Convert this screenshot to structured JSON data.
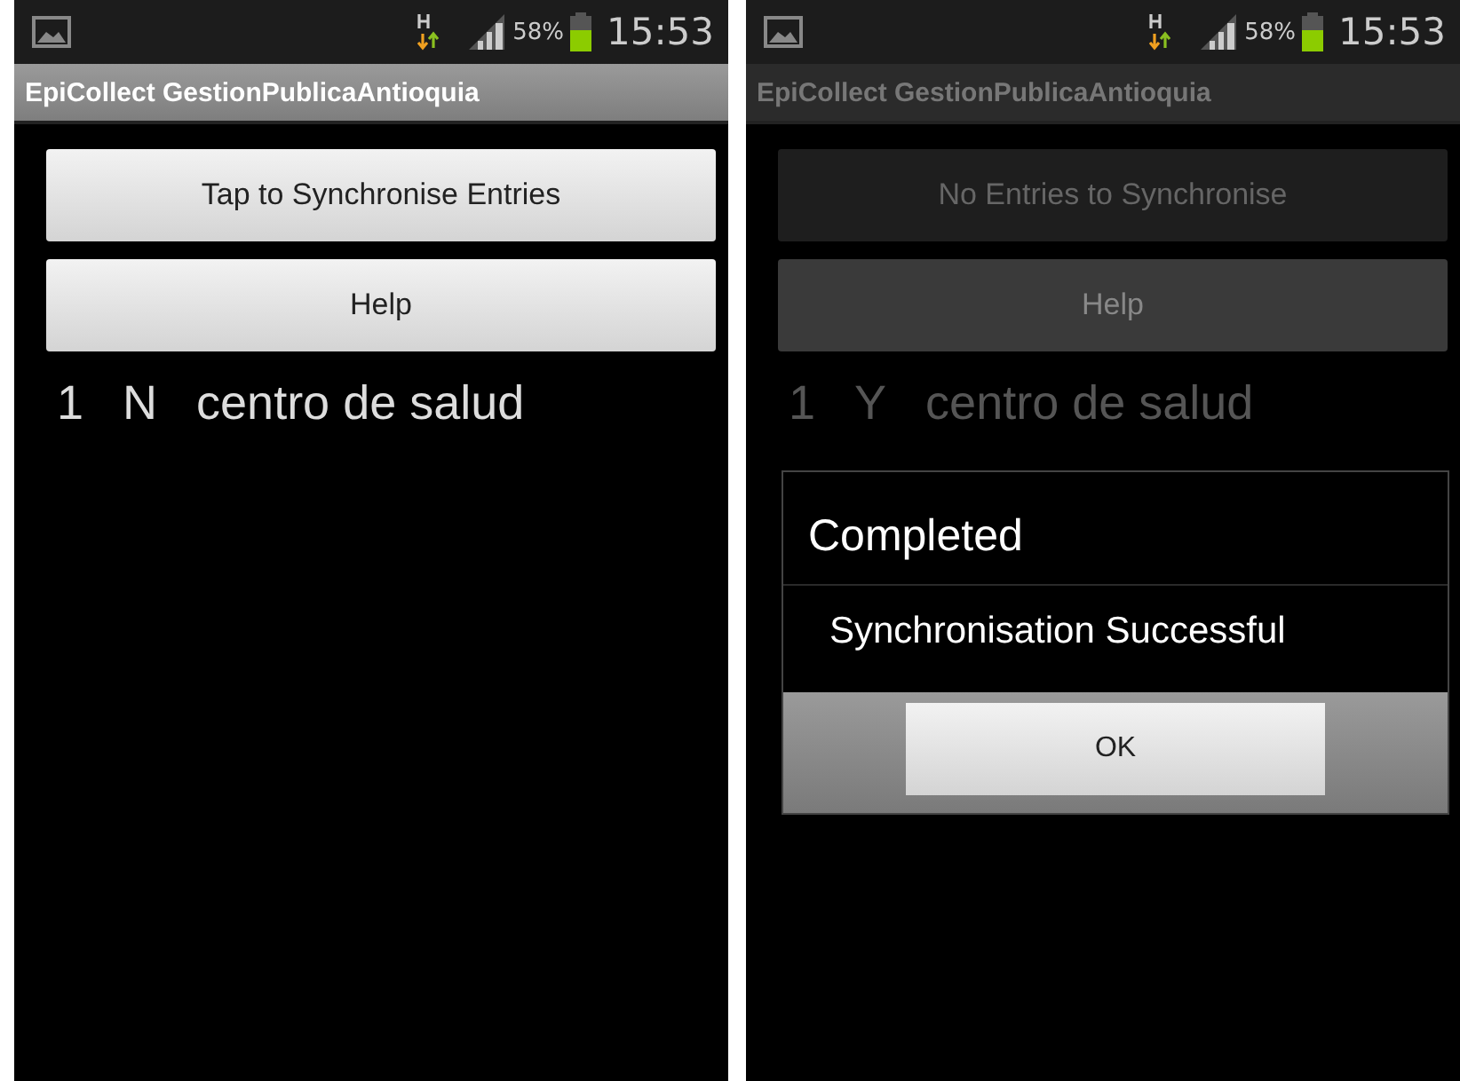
{
  "screens": [
    {
      "status_bar": {
        "battery": "58%",
        "time": "15:53"
      },
      "title": "EpiCollect GestionPublicaAntioquia",
      "dimmed": false,
      "buttons": [
        {
          "label": "Tap to Synchronise Entries",
          "disabled": false
        },
        {
          "label": "Help",
          "disabled": false
        }
      ],
      "entries": [
        {
          "number": "1",
          "status": "N",
          "name": "centro de salud"
        }
      ]
    },
    {
      "status_bar": {
        "battery": "58%",
        "time": "15:53"
      },
      "title": "EpiCollect GestionPublicaAntioquia",
      "dimmed": true,
      "buttons": [
        {
          "label": "No Entries to Synchronise",
          "disabled": true
        },
        {
          "label": "Help",
          "disabled": false
        }
      ],
      "entries": [
        {
          "number": "1",
          "status": "Y",
          "name": "centro de salud"
        }
      ],
      "dialog": {
        "title": "Completed",
        "message": "Synchronisation Successful",
        "button": "OK"
      }
    }
  ]
}
